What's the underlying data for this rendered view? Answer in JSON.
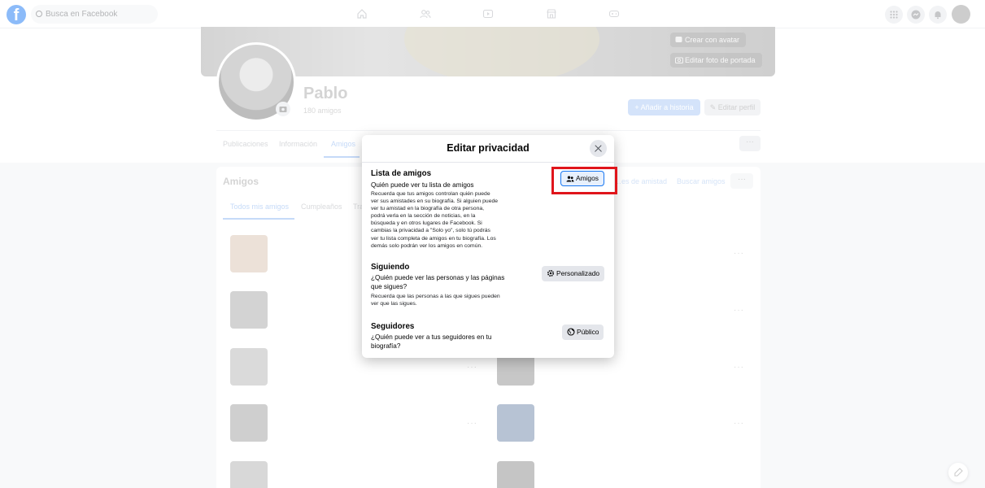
{
  "topbar": {
    "search_placeholder": "Busca en Facebook",
    "nav_icons": [
      "home-icon",
      "friends-icon",
      "watch-icon",
      "marketplace-icon",
      "gaming-icon"
    ],
    "right_icons": [
      "menu-grid-icon",
      "messenger-icon",
      "notifications-icon",
      "account-avatar"
    ]
  },
  "cover": {
    "create_avatar": "Crear con avatar",
    "edit_cover": "Editar foto de portada"
  },
  "profile": {
    "name": "Pablo",
    "friends_count": "180 amigos",
    "add_story": "Añadir a historia",
    "edit_profile": "Editar perfil",
    "tabs": [
      "Publicaciones",
      "Información",
      "Amigos"
    ],
    "more": "···"
  },
  "friends_section": {
    "title": "Amigos",
    "requests_link": "…es de amistad",
    "find_friends": "Buscar amigos",
    "more": "···",
    "tabs": [
      "Todos mis amigos",
      "Cumpleaños",
      "Tra…"
    ],
    "row_menu": "···"
  },
  "modal": {
    "title": "Editar privacidad",
    "sections": [
      {
        "title": "Lista de amigos",
        "subtitle": "Quién puede ver tu lista de amigos",
        "desc_lines": [
          "Recuerda que tus amigos controlan quién puede",
          "ver sus amistades en su biografía. Si alguien puede",
          "ver tu amistad en la biografía de otra persona,",
          "podrá verla en la sección de noticias, en la",
          "búsqueda y en otros lugares de Facebook. Si",
          "cambias la privacidad a \"Solo yo\", solo tú podrás",
          "ver tu lista completa de amigos en tu biografía. Los",
          "demás solo podrán ver los amigos en común."
        ],
        "button": "Amigos",
        "button_icon": "friends-icon"
      },
      {
        "title": "Siguiendo",
        "subtitle_lines": [
          "¿Quién puede ver las personas y las páginas",
          "que sigues?"
        ],
        "desc_lines": [
          "Recuerda que las personas a las que sigues pueden",
          "ver que las sigues."
        ],
        "button": "Personalizado",
        "button_icon": "gear-icon"
      },
      {
        "title": "Seguidores",
        "subtitle_lines": [
          "¿Quién puede ver a tus seguidores en tu",
          "biografía?"
        ],
        "button": "Público",
        "button_icon": "globe-icon"
      }
    ]
  },
  "colors": {
    "brand": "#1877f2",
    "highlight": "#e0151b"
  }
}
